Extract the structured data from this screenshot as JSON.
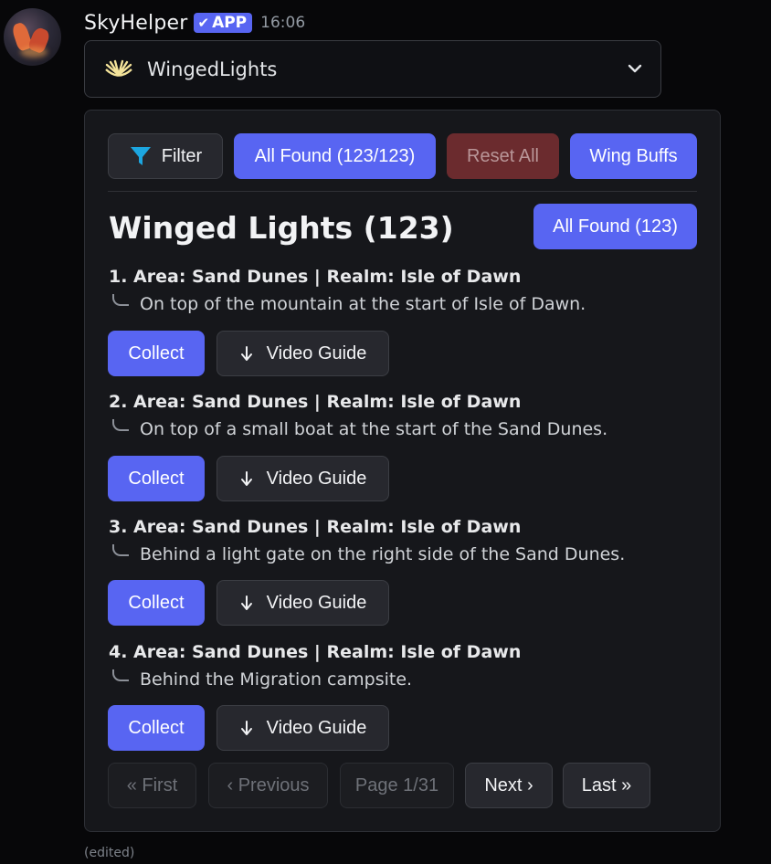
{
  "message": {
    "username": "SkyHelper",
    "app_badge": "APP",
    "timestamp": "16:06",
    "edited_label": "(edited)"
  },
  "select": {
    "selected_label": "WingedLights",
    "icon": "winged-light-icon"
  },
  "toolbar": {
    "filter_label": "Filter",
    "all_found_label": "All Found (123/123)",
    "reset_all_label": "Reset All",
    "wing_buffs_label": "Wing Buffs"
  },
  "embed": {
    "title": "Winged Lights (123)",
    "all_found_button": "All Found (123)"
  },
  "entries": [
    {
      "heading": "1. Area: Sand Dunes | Realm: Isle of Dawn",
      "description": "On top of the mountain at the start of Isle of Dawn.",
      "collect_label": "Collect",
      "video_label": "Video Guide"
    },
    {
      "heading": "2. Area: Sand Dunes | Realm: Isle of Dawn",
      "description": "On top of a small boat at the start of the Sand Dunes.",
      "collect_label": "Collect",
      "video_label": "Video Guide"
    },
    {
      "heading": "3. Area: Sand Dunes | Realm: Isle of Dawn",
      "description": "Behind a light gate on the right side of the Sand Dunes.",
      "collect_label": "Collect",
      "video_label": "Video Guide"
    },
    {
      "heading": "4. Area: Sand Dunes | Realm: Isle of Dawn",
      "description": "Behind the Migration campsite.",
      "collect_label": "Collect",
      "video_label": "Video Guide"
    }
  ],
  "pagination": {
    "first": "« First",
    "previous": "‹ Previous",
    "page": "Page 1/31",
    "next": "Next ›",
    "last": "Last »"
  },
  "colors": {
    "brand": "#5865f2",
    "background": "#070709",
    "embed": "#16171b",
    "filter_icon": "#1ca6e0"
  }
}
